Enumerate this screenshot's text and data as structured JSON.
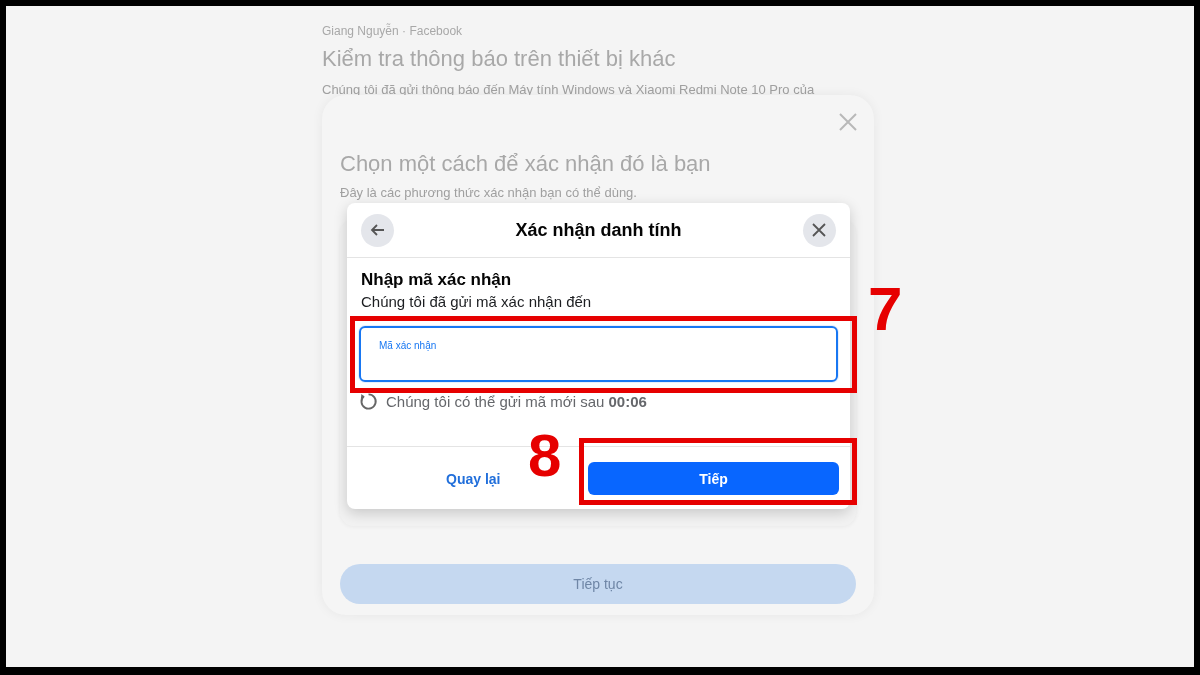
{
  "page": {
    "account": "Giang Nguyễn · Facebook",
    "title": "Kiểm tra thông báo trên thiết bị khác",
    "text": "Chúng tôi đã gửi thông báo đến Máy tính Windows và Xiaomi Redmi Note 10 Pro của"
  },
  "card": {
    "title": "Chọn một cách để xác nhận đó là bạn",
    "subtitle": "Đây là các phương thức xác nhận bạn có thể dùng.",
    "button": "Tiếp tục",
    "button_disabled": true
  },
  "dialog": {
    "title": "Xác nhận danh tính",
    "heading": "Nhập mã xác nhận",
    "text": "Chúng tôi đã gửi mã xác nhận đến",
    "field": {
      "label": "Mã xác nhận",
      "focused": true
    },
    "resend": "Chúng tôi có thể gửi mã mới sau **00:06**",
    "buttons": [
      {
        "label": "Quay lại",
        "kind": "link"
      },
      {
        "label": "Tiếp",
        "kind": "primary"
      }
    ]
  },
  "annotations": [
    {
      "label": "7"
    },
    {
      "label": "8"
    }
  ]
}
